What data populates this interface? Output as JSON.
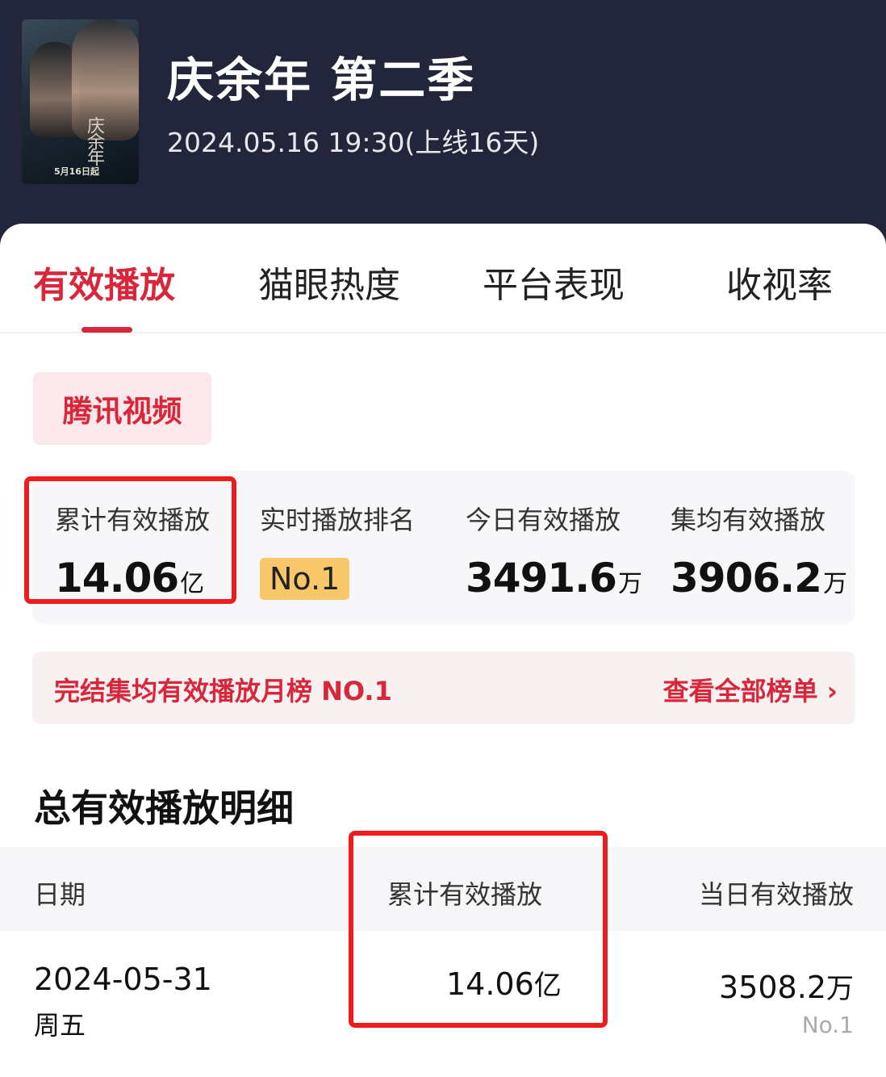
{
  "header": {
    "poster_calligraphy": "庆余年",
    "poster_date": "5月16日起",
    "title": "庆余年 第二季",
    "subtitle": "2024.05.16 19:30(上线16天)"
  },
  "tabs": [
    {
      "label": "有效播放",
      "active": true
    },
    {
      "label": "猫眼热度",
      "active": false
    },
    {
      "label": "平台表现",
      "active": false
    },
    {
      "label": "收视率",
      "active": false
    }
  ],
  "platform": "腾讯视频",
  "stats": {
    "cumulative": {
      "label": "累计有效播放",
      "value": "14.06",
      "unit": "亿"
    },
    "realtime_rank": {
      "label": "实时播放排名",
      "value": "No.1"
    },
    "today": {
      "label": "今日有效播放",
      "value": "3491.6",
      "unit": "万"
    },
    "per_episode": {
      "label": "集均有效播放",
      "value": "3906.2",
      "unit": "万"
    }
  },
  "ranking_banner": {
    "text": "完结集均有效播放月榜 NO.1",
    "link": "查看全部榜单 ›"
  },
  "detail": {
    "title": "总有效播放明细",
    "columns": [
      "日期",
      "累计有效播放",
      "当日有效播放"
    ],
    "rows": [
      {
        "date": "2024-05-31",
        "weekday": "周五",
        "cumulative": "14.06",
        "cumulative_unit": "亿",
        "daily": "3508.2",
        "daily_unit": "万",
        "daily_rank": "No.1"
      }
    ]
  },
  "colors": {
    "header_bg": "#23263a",
    "accent": "#d8263a",
    "highlight_box": "#ee1c1c",
    "rank_badge": "#f8c76a"
  }
}
